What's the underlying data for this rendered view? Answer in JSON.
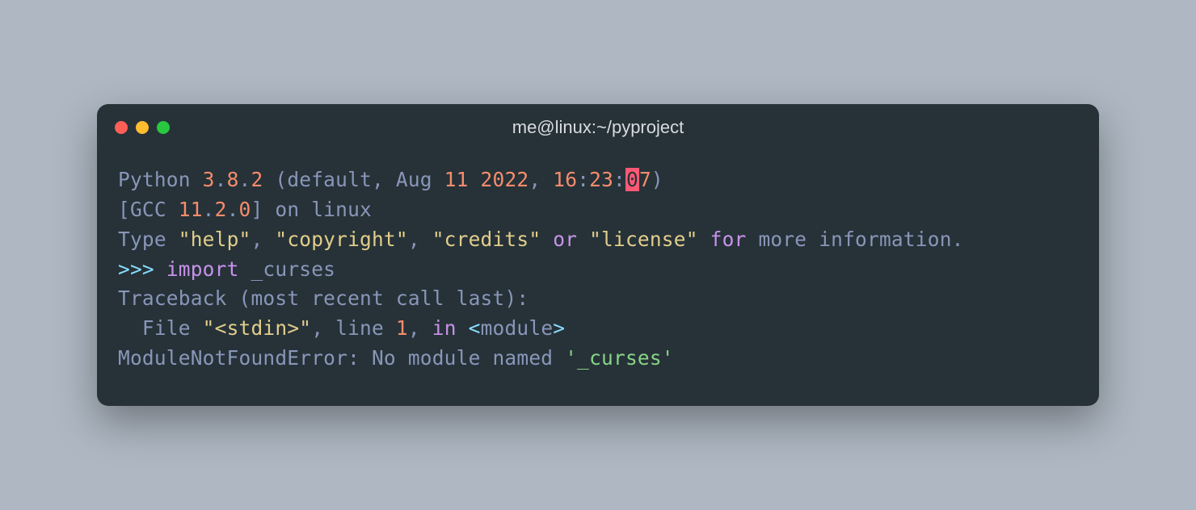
{
  "titlebar": {
    "title": "me@linux:~/pyproject"
  },
  "line1": {
    "python": "Python",
    "ver_a": "3",
    "dot1": ".",
    "ver_b": "8",
    "dot2": ".",
    "ver_c": "2",
    "open": " (",
    "default": "default",
    "comma1": ", ",
    "month": "Aug",
    "day": " 11",
    "year": " 2022",
    "comma2": ", ",
    "hh": "16",
    "colon1": ":",
    "mm": "23",
    "colon2": ":",
    "ss1": "0",
    "ss2": "7",
    "close": ")"
  },
  "line2": {
    "open": "[",
    "gcc": "GCC",
    "maj": " 11",
    "dot1": ".",
    "min": "2",
    "dot2": ".",
    "patch": "0",
    "close": "]",
    "on": " on ",
    "linux": "linux"
  },
  "line3": {
    "type": "Type",
    "s1": " ",
    "help": "\"help\"",
    "c1": ", ",
    "copyright": "\"copyright\"",
    "c2": ", ",
    "credits": "\"credits\"",
    "or": " or ",
    "license": "\"license\"",
    "s2": " ",
    "for": "for",
    "s3": " ",
    "more": "more",
    "s4": " ",
    "information": "information",
    "dot": "."
  },
  "line4": {
    "prompt": ">>>",
    "s1": " ",
    "import": "import",
    "s2": " ",
    "mod": "_curses"
  },
  "line5": {
    "traceback": "Traceback",
    "open": " (",
    "mrcl": "most recent call last",
    "close": "):"
  },
  "line6": {
    "indent": "  ",
    "file": "File",
    "s1": " ",
    "stdin": "\"<stdin>\"",
    "c1": ", ",
    "line": "line",
    "s2": " ",
    "one": "1",
    "c2": ", ",
    "in": "in",
    "s3": " ",
    "lt": "<",
    "module": "module",
    "gt": ">"
  },
  "line7": {
    "err": "ModuleNotFoundError",
    "colon": ": ",
    "msg": "No module named ",
    "q1": "'",
    "mod": "_curses",
    "q2": "'"
  }
}
